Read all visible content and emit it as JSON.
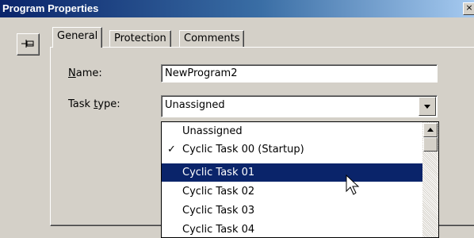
{
  "window": {
    "title": "Program Properties",
    "close_glyph": "×"
  },
  "tabs": [
    {
      "label": "General",
      "active": true
    },
    {
      "label": "Protection",
      "active": false
    },
    {
      "label": "Comments",
      "active": false
    }
  ],
  "general": {
    "name_label_accel": "N",
    "name_label_rest": "ame:",
    "name_value": "NewProgram2",
    "task_label_pre": "Task ",
    "task_label_accel": "t",
    "task_label_post": "ype:",
    "task_value": "Unassigned"
  },
  "task_options": [
    {
      "label": "Unassigned",
      "checked": false,
      "selected": false
    },
    {
      "label": "Cyclic Task 00 (Startup)",
      "checked": true,
      "selected": false
    },
    {
      "label": "Cyclic Task 01",
      "checked": false,
      "selected": true
    },
    {
      "label": "Cyclic Task 02",
      "checked": false,
      "selected": false
    },
    {
      "label": "Cyclic Task 03",
      "checked": false,
      "selected": false
    },
    {
      "label": "Cyclic Task 04",
      "checked": false,
      "selected": false
    }
  ],
  "check_glyph": "✓",
  "icons": {
    "pin": "pin-icon",
    "cursor": "mouse-pointer-icon"
  },
  "colors": {
    "titlebar": "#0a246a",
    "selection": "#0a246a",
    "face": "#d4d0c8"
  }
}
